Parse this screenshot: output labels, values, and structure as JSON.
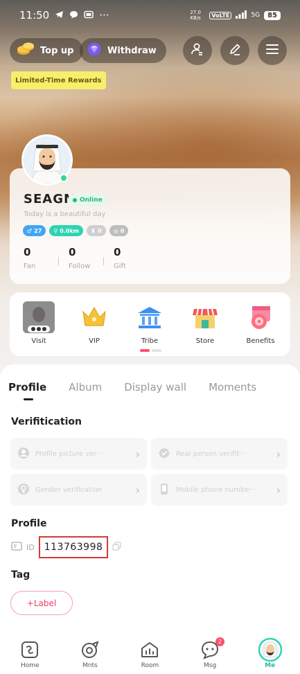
{
  "status_bar": {
    "time": "11:50",
    "dots": "···",
    "net_speed": "27.0 KB/s",
    "vo_lte": "VoLTE",
    "sig_label": "5G",
    "battery": "85"
  },
  "header": {
    "top_up": "Top up",
    "withdraw": "Withdraw",
    "promo": "Limited-Time Rewards"
  },
  "profile": {
    "name": "SEAGM",
    "status": "Online",
    "bio": "Today is a beautiful day",
    "tags": {
      "gender_age": "27",
      "distance": "0.0km",
      "level_a": "0",
      "level_b": "0"
    },
    "stats": [
      {
        "num": "0",
        "label": "Fan"
      },
      {
        "num": "0",
        "label": "Follow"
      },
      {
        "num": "0",
        "label": "Gift"
      }
    ]
  },
  "shortcuts": {
    "visit": "Visit",
    "vip": "VIP",
    "tribe": "Tribe",
    "store": "Store",
    "benefits": "Benefits"
  },
  "tabs": {
    "profile": "Profile",
    "album": "Album",
    "display_wall": "Display wall",
    "moments": "Moments"
  },
  "verification": {
    "title": "Verifitication",
    "picture": "Profile picture ver···",
    "real_person": "Real person verifit···",
    "gender": "Gender verification",
    "phone": "Mobile phone numbe···"
  },
  "profile_section": {
    "title": "Profile",
    "id_label": "ID",
    "id_value": "113763998"
  },
  "tag_section": {
    "title": "Tag",
    "add_label": "+Label"
  },
  "nav": {
    "home": "Home",
    "mnts": "Mnts",
    "room": "Room",
    "msg": "Msg",
    "msg_badge": "2",
    "me": "Me"
  },
  "colors": {
    "accent": "#ee3d66",
    "online": "#28b874"
  }
}
